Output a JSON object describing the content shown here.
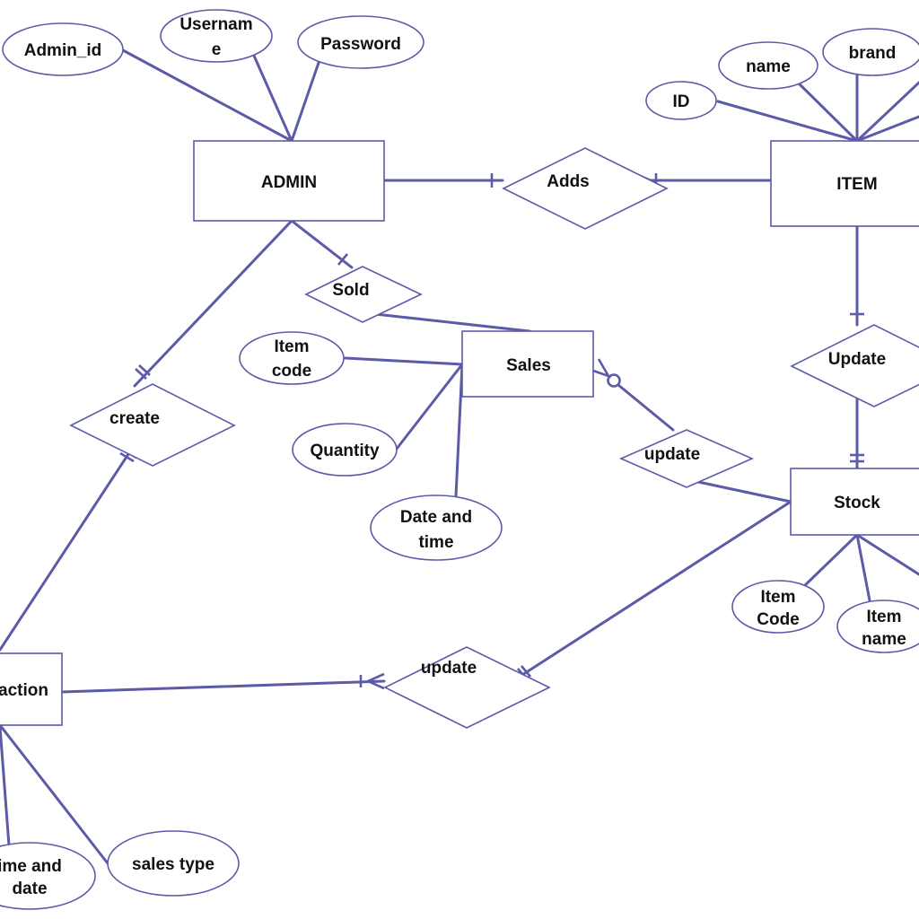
{
  "diagram": {
    "type": "er-diagram",
    "line_color": "#5b5ba8",
    "entities": {
      "admin": "ADMIN",
      "item": "ITEM",
      "sales": "Sales",
      "stock": "Stock",
      "transaction": "action"
    },
    "relationships": {
      "adds": "Adds",
      "sold": "Sold",
      "create": "create",
      "update_item_stock": "Update",
      "update_sales_stock": "update",
      "update_transaction_stock": "update"
    },
    "attributes": {
      "admin_id": [
        "Admin_id"
      ],
      "username": [
        "Usernam",
        "e"
      ],
      "password": [
        "Password"
      ],
      "item_id": [
        "ID"
      ],
      "item_name": [
        "name"
      ],
      "item_brand": [
        "brand"
      ],
      "sales_item_code": [
        "Item",
        "code"
      ],
      "sales_quantity": [
        "Quantity"
      ],
      "sales_date_time": [
        "Date and",
        "time"
      ],
      "stock_item_code": [
        "Item",
        "Code"
      ],
      "stock_item_name": [
        "Item",
        "name"
      ],
      "transaction_time_date": [
        "ime and",
        "date"
      ],
      "transaction_sales_type": [
        "sales type"
      ]
    }
  }
}
